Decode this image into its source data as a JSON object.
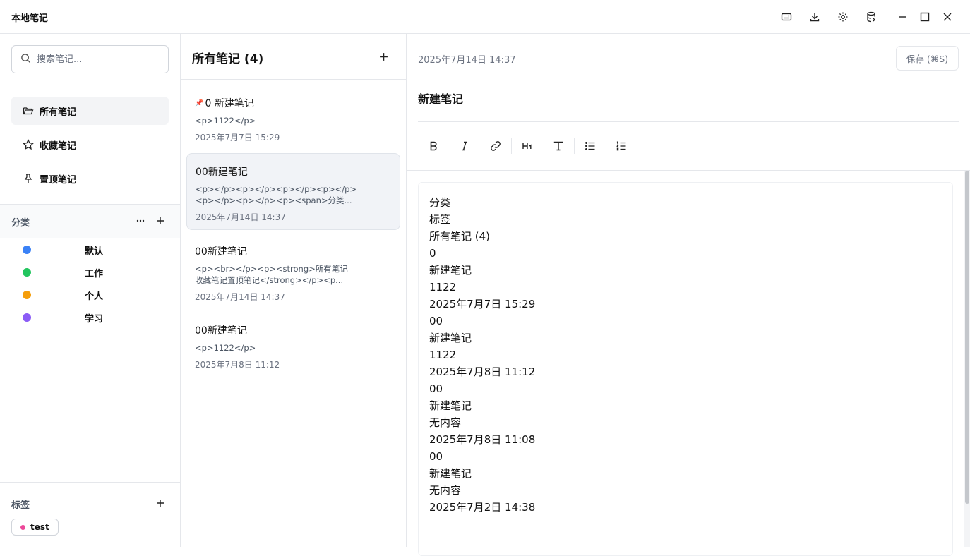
{
  "app": {
    "title": "本地笔记"
  },
  "titlebar": {
    "icons": [
      "keyboard-icon",
      "download-icon",
      "gear-icon",
      "database-icon",
      "minimize-icon",
      "maximize-icon",
      "close-icon"
    ]
  },
  "sidebar": {
    "search_placeholder": "搜索笔记...",
    "nav": [
      {
        "label": "所有笔记",
        "icon": "folder-open-icon",
        "active": true
      },
      {
        "label": "收藏笔记",
        "icon": "star-icon",
        "active": false
      },
      {
        "label": "置顶笔记",
        "icon": "pin-icon",
        "active": false
      }
    ],
    "categories_title": "分类",
    "categories": [
      {
        "name": "默认",
        "color": "#3b82f6"
      },
      {
        "name": "工作",
        "color": "#22c55e"
      },
      {
        "name": "个人",
        "color": "#f59e0b"
      },
      {
        "name": "学习",
        "color": "#8b5cf6"
      }
    ],
    "tags_title": "标签",
    "tags": [
      {
        "name": "test",
        "color": "#ec4899"
      }
    ]
  },
  "list": {
    "title": "所有笔记 (4)",
    "notes": [
      {
        "title": "0  新建笔记",
        "pinned": true,
        "preview": "<p>1122</p>",
        "preview2": "",
        "date": "2025年7月7日 15:29"
      },
      {
        "title": "00新建笔记",
        "pinned": false,
        "preview": "<p></p><p></p><p></p><p></p>",
        "preview2": "<p></p><p></p><p><span>分类...",
        "date": "2025年7月14日 14:37"
      },
      {
        "title": "00新建笔记",
        "pinned": false,
        "preview": "<p><br></p><p><strong>所有笔记",
        "preview2": "收藏笔记置顶笔记</strong></p><p...",
        "date": "2025年7月14日 14:37"
      },
      {
        "title": "00新建笔记",
        "pinned": false,
        "preview": "<p>1122</p>",
        "preview2": "",
        "date": "2025年7月8日 11:12"
      }
    ]
  },
  "editor": {
    "date": "2025年7月14日 14:37",
    "save_label": "保存 (⌘S)",
    "title": "新建笔记",
    "toolbar": [
      "bold-icon",
      "italic-icon",
      "link-icon",
      "heading1-icon",
      "text-icon",
      "bullet-list-icon",
      "ordered-list-icon"
    ],
    "lines": [
      "分类",
      "标签",
      "所有笔记 (4)",
      "0",
      "新建笔记",
      "1122",
      "2025年7月7日 15:29",
      "00",
      "新建笔记",
      "1122",
      "2025年7月8日 11:12",
      "00",
      "新建笔记",
      "无内容",
      "2025年7月8日 11:08",
      "00",
      "新建笔记",
      "无内容",
      "2025年7月2日 14:38"
    ]
  }
}
